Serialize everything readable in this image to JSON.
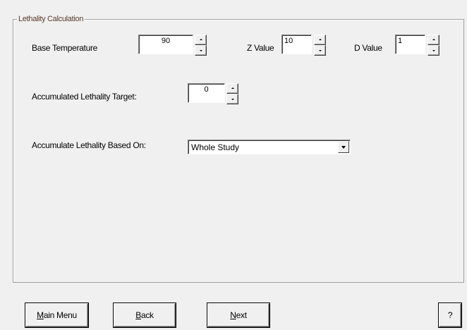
{
  "group": {
    "title": "Lethality Calculation"
  },
  "base_temperature": {
    "label": "Base Temperature",
    "value": "90"
  },
  "z_value": {
    "label": "Z Value",
    "value": "10"
  },
  "d_value": {
    "label": "D Value",
    "value": "1"
  },
  "lethality_target": {
    "label": "Accumulated Lethality Target:",
    "value": "0"
  },
  "accumulate_based_on": {
    "label": "Accumulate Lethality Based On:",
    "selected": "Whole Study"
  },
  "buttons": {
    "main_menu": {
      "mnemonic": "M",
      "rest": "ain Menu"
    },
    "back": {
      "mnemonic": "B",
      "rest": "ack"
    },
    "next": {
      "mnemonic": "N",
      "rest": "ext"
    },
    "help": "?"
  }
}
